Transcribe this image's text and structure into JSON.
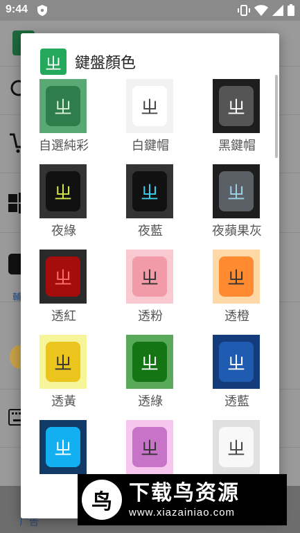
{
  "status_bar": {
    "time": "9:44"
  },
  "background_app": {
    "side_letter": "輔",
    "ad_text": "广告"
  },
  "dialog": {
    "app_icon_glyph": "ㄓ",
    "title": "鍵盤顏色",
    "items": [
      {
        "label": "自選純彩",
        "bg": "#5aa874",
        "key": "#2e7d4a",
        "glyph_color": "#d8f0d8"
      },
      {
        "label": "白鍵帽",
        "bg": "#f2f2f2",
        "key": "#ffffff",
        "glyph_color": "#444444"
      },
      {
        "label": "黑鍵帽",
        "bg": "#1e1e1e",
        "key": "#555555",
        "glyph_color": "#ffffff"
      },
      {
        "label": "夜綠",
        "bg": "#333333",
        "key": "#111111",
        "glyph_color": "#d6e84a"
      },
      {
        "label": "夜藍",
        "bg": "#333333",
        "key": "#111111",
        "glyph_color": "#3cd0f0"
      },
      {
        "label": "夜蘋果灰",
        "bg": "#1e1e1e",
        "key": "#5a6066",
        "glyph_color": "#9bd2e6"
      },
      {
        "label": "透紅",
        "bg": "#2a2a2a",
        "key": "#a50d0d",
        "glyph_color": "#ff6e6e"
      },
      {
        "label": "透粉",
        "bg": "#f9c9d2",
        "key": "#f39aa8",
        "glyph_color": "#333333"
      },
      {
        "label": "透橙",
        "bg": "#ffd8a8",
        "key": "#ff8a30",
        "glyph_color": "#333333"
      },
      {
        "label": "透黃",
        "bg": "#f6f59a",
        "key": "#ebc41e",
        "glyph_color": "#333333"
      },
      {
        "label": "透綠",
        "bg": "#5aa85a",
        "key": "#157515",
        "glyph_color": "#ffffff"
      },
      {
        "label": "透藍",
        "bg": "#153c7a",
        "key": "#1f5bb0",
        "glyph_color": "#ffffff"
      },
      {
        "label": "",
        "bg": "#123a66",
        "key": "#12b0f0",
        "glyph_color": "#ffffff"
      },
      {
        "label": "",
        "bg": "#f7c6ee",
        "key": "#c774c8",
        "glyph_color": "#333333"
      },
      {
        "label": "",
        "bg": "#e0e0e0",
        "key": "#f8f8f8",
        "glyph_color": "#444444"
      }
    ]
  },
  "watermark": {
    "logo_glyph": "鸟",
    "title": "下载鸟资源",
    "url": "www.xiazainiao.com"
  }
}
